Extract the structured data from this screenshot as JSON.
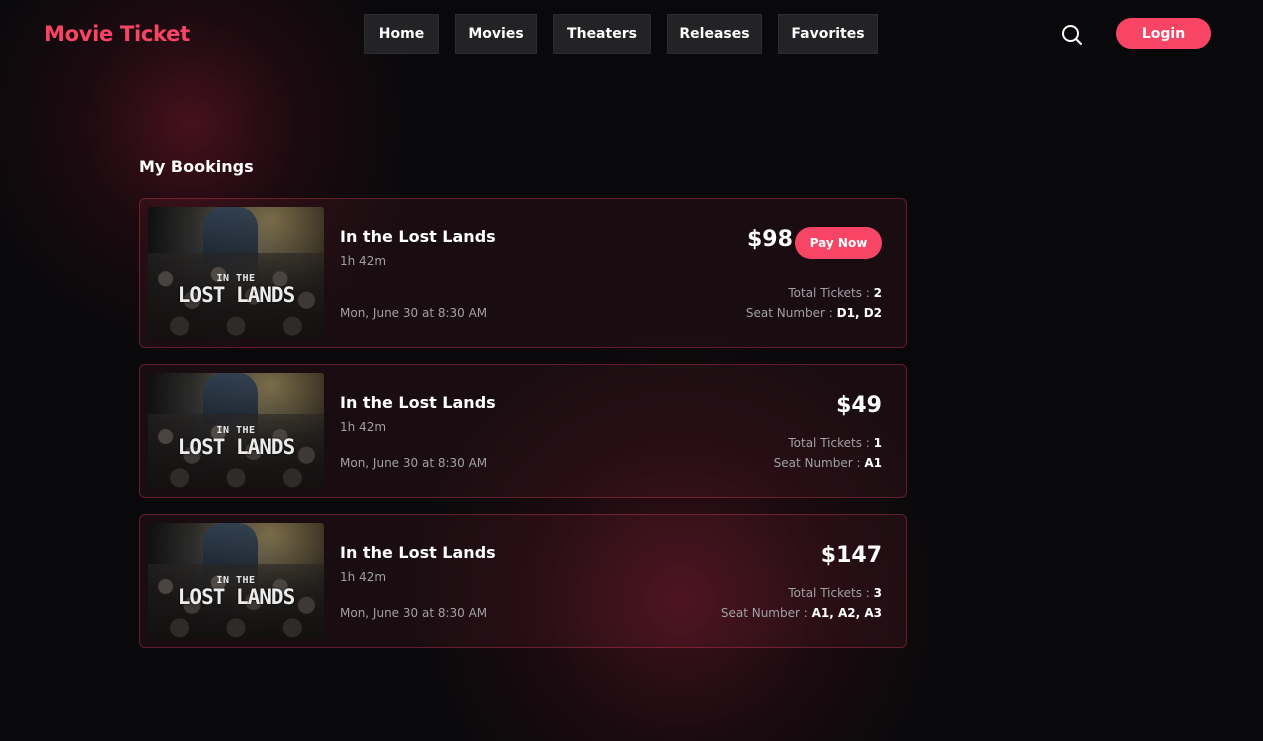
{
  "app": {
    "logo": "Movie Ticket"
  },
  "nav": {
    "items": [
      "Home",
      "Movies",
      "Theaters",
      "Releases",
      "Favorites"
    ]
  },
  "header": {
    "login_label": "Login",
    "search_icon": "search-icon"
  },
  "accent_color": "#f84565",
  "page": {
    "title": "My Bookings"
  },
  "poster": {
    "line1": "IN THE",
    "line2": "LOST LANDS"
  },
  "labels": {
    "total_tickets": "Total Tickets :",
    "seat_number": "Seat Number :"
  },
  "bookings": [
    {
      "title": "In the Lost Lands",
      "duration": "1h 42m",
      "showtime": "Mon, June 30 at 8:30 AM",
      "price": "$98",
      "pay_label": "Pay Now",
      "total_tickets": "2",
      "seats": "D1, D2"
    },
    {
      "title": "In the Lost Lands",
      "duration": "1h 42m",
      "showtime": "Mon, June 30 at 8:30 AM",
      "price": "$49",
      "total_tickets": "1",
      "seats": "A1"
    },
    {
      "title": "In the Lost Lands",
      "duration": "1h 42m",
      "showtime": "Mon, June 30 at 8:30 AM",
      "price": "$147",
      "total_tickets": "3",
      "seats": "A1, A2, A3"
    }
  ]
}
